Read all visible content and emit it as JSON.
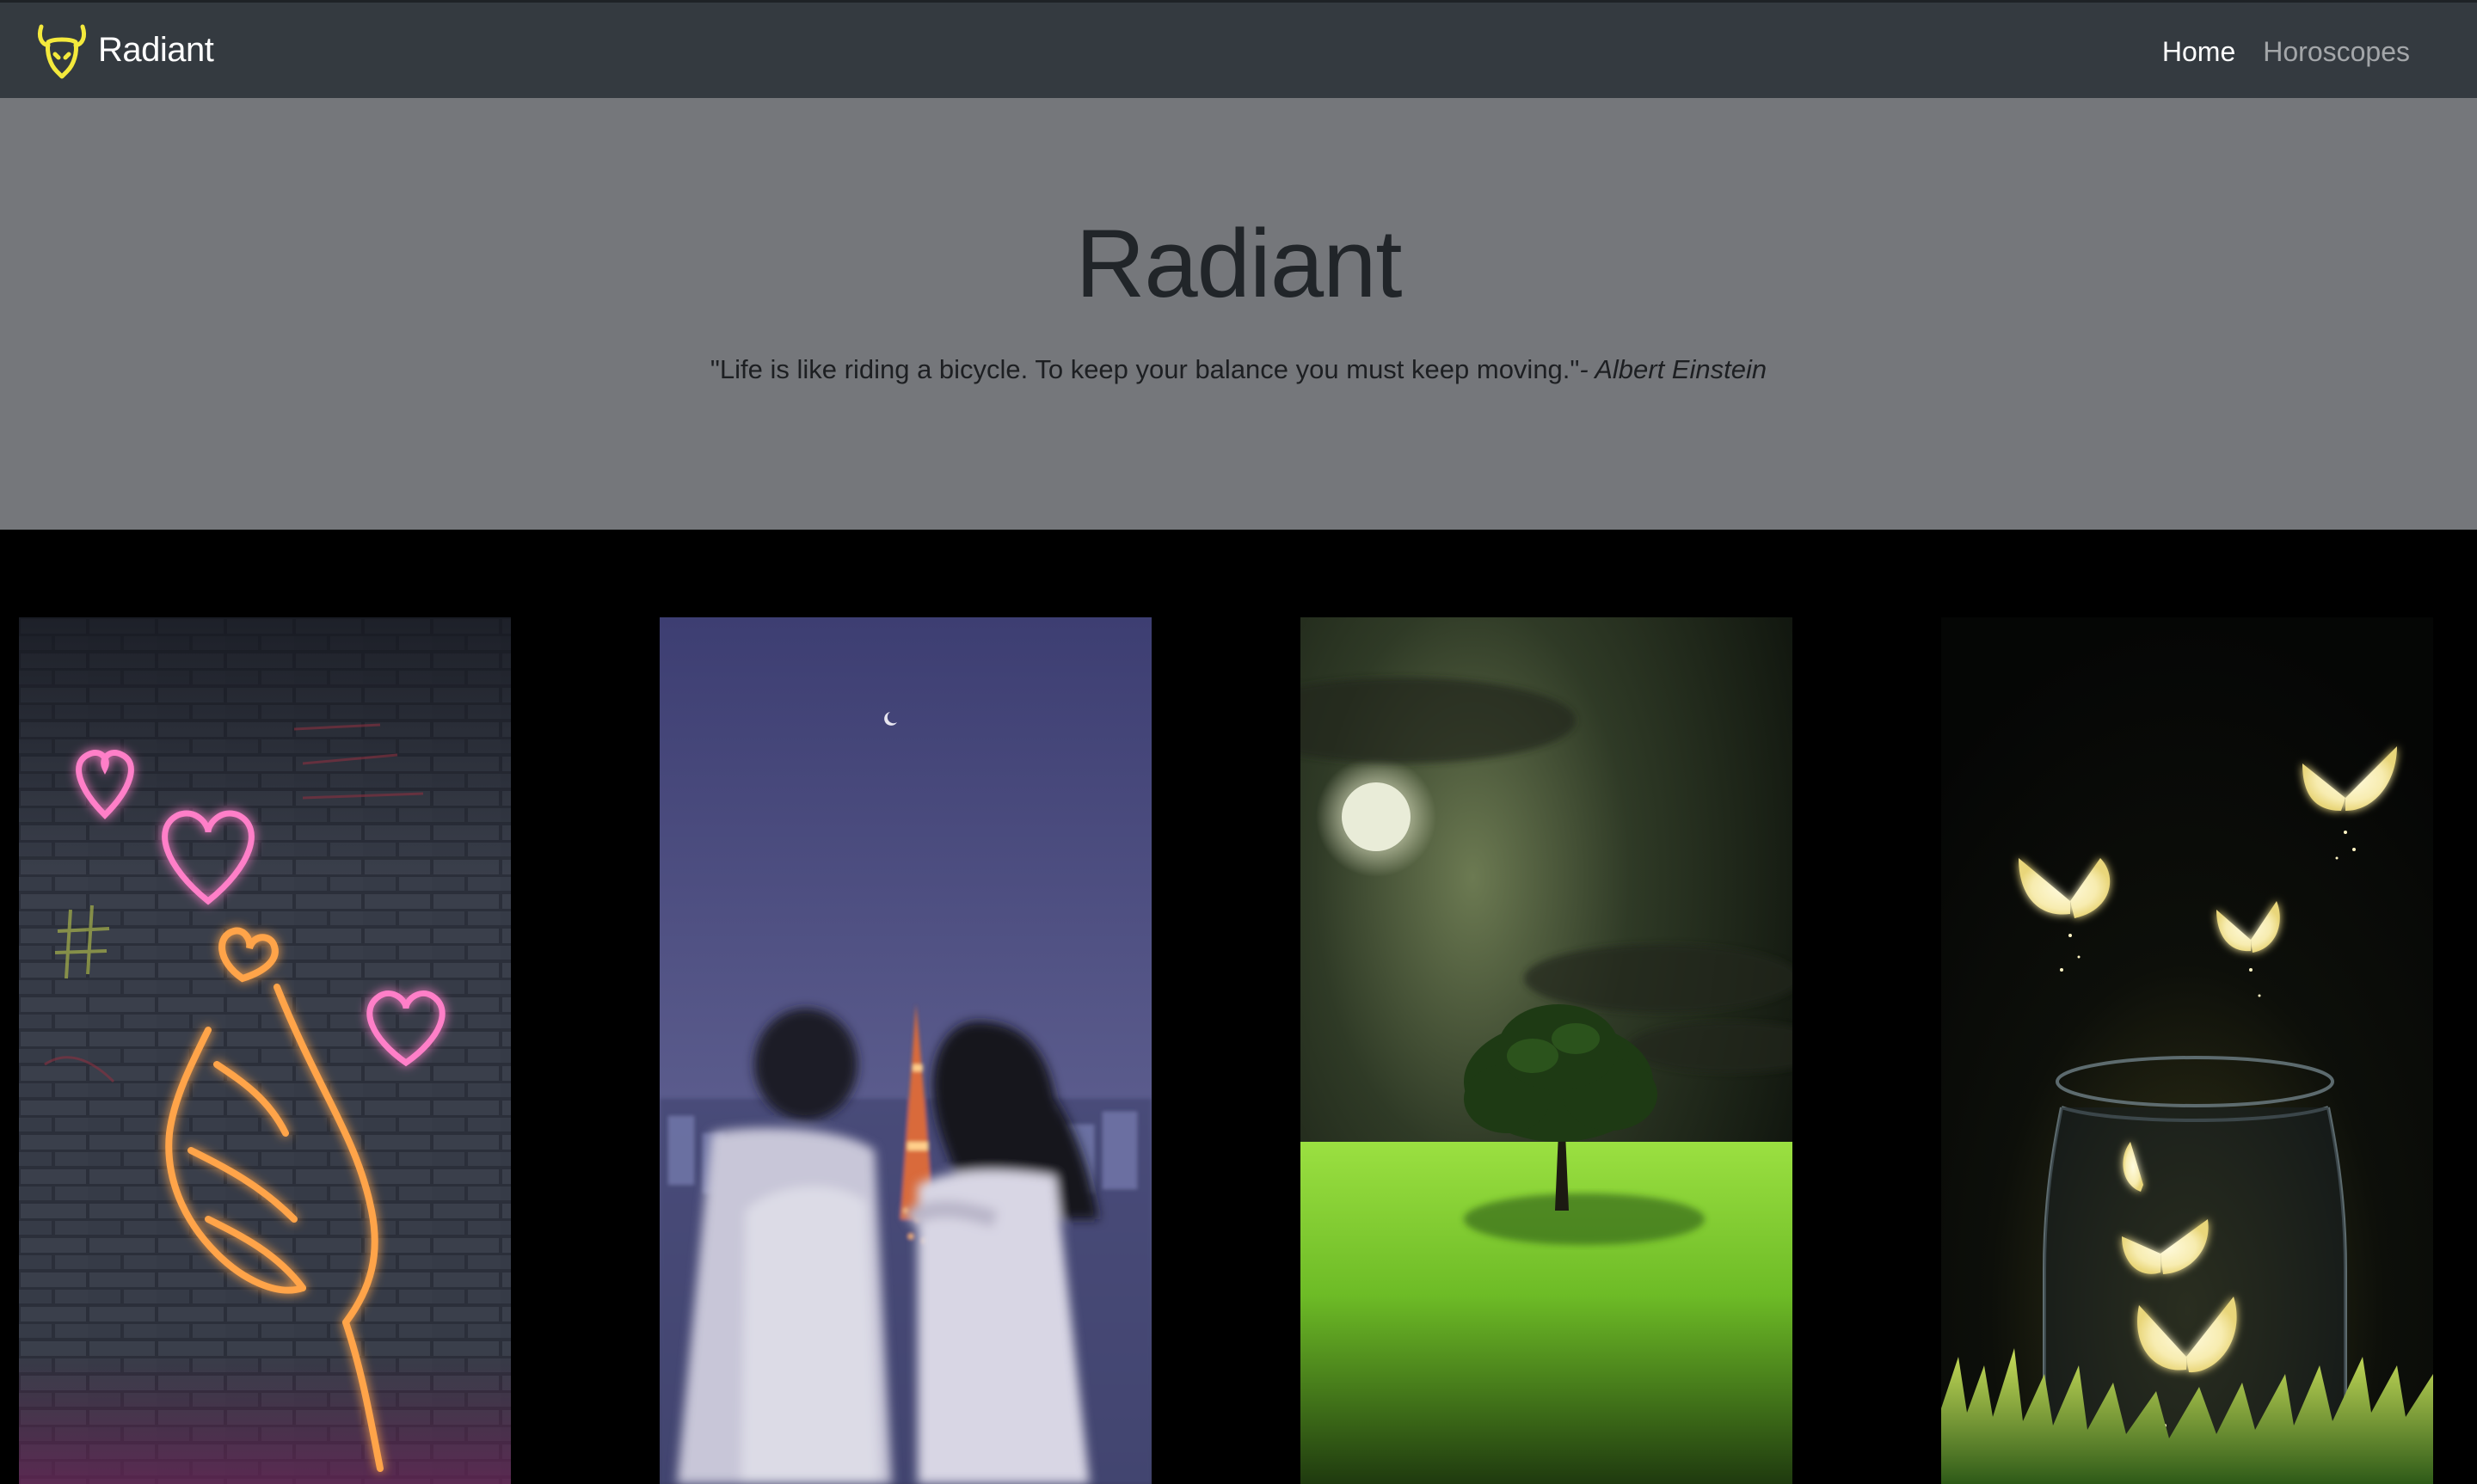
{
  "navbar": {
    "brand_text": "Radiant",
    "brand_icon": "bull-head-logo-icon",
    "links": [
      {
        "label": "Home",
        "active": true
      },
      {
        "label": "Horoscopes",
        "active": false
      }
    ]
  },
  "hero": {
    "title": "Radiant",
    "quote": "\"Life is like riding a bicycle. To keep your balance you must keep moving.\"",
    "author": "- Albert Einstein"
  },
  "gallery": {
    "images": [
      {
        "name": "neon-hearts-finger-heart-image"
      },
      {
        "name": "couple-tokyo-tower-night-image"
      },
      {
        "name": "moonlit-tree-field-image"
      },
      {
        "name": "glowing-butterflies-jar-image"
      }
    ]
  },
  "colors": {
    "navbar_bg": "#343a40",
    "hero_bg": "#75777b",
    "page_bg": "#000000",
    "brand_accent": "#f4e93c"
  }
}
